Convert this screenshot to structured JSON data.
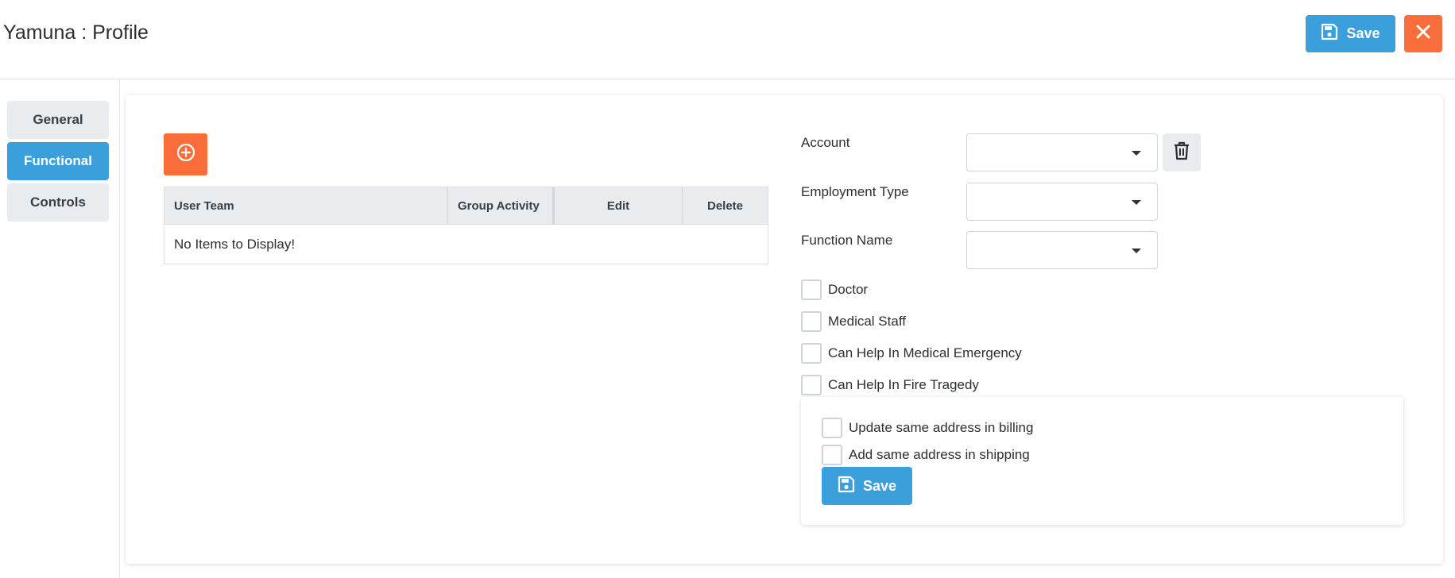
{
  "header": {
    "title": "Yamuna : Profile",
    "save_label": "Save",
    "close_icon": "close-icon"
  },
  "sidebar": {
    "items": [
      {
        "label": "General",
        "active": false
      },
      {
        "label": "Functional",
        "active": true
      },
      {
        "label": "Controls",
        "active": false
      }
    ]
  },
  "grid": {
    "add_icon": "plus-circle-icon",
    "columns": [
      "User Team",
      "Group Activity",
      "Edit",
      "Delete"
    ],
    "empty_message": "No Items to Display!"
  },
  "form": {
    "account_label": "Account",
    "account_value": "",
    "employment_type_label": "Employment Type",
    "employment_type_value": "",
    "function_name_label": "Function Name",
    "function_name_value": "",
    "delete_icon": "trash-icon",
    "checkboxes": [
      {
        "label": "Doctor",
        "checked": false
      },
      {
        "label": "Medical Staff",
        "checked": false
      },
      {
        "label": "Can Help In Medical Emergency",
        "checked": false
      },
      {
        "label": "Can Help In Fire Tragedy",
        "checked": false
      }
    ]
  },
  "address": {
    "update_billing_label": "Update same address in billing",
    "update_billing_checked": false,
    "add_shipping_label": "Add same address in shipping",
    "add_shipping_checked": false,
    "save_label": "Save"
  },
  "colors": {
    "primary": "#3a9fdb",
    "accent": "#f96d3a",
    "nav_inactive": "#e9ecef"
  }
}
